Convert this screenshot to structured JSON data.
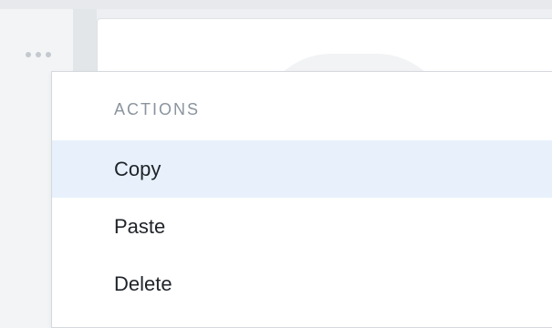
{
  "window": {
    "more_icon": "ellipsis-horizontal-icon"
  },
  "menu": {
    "heading": "ACTIONS",
    "items": [
      {
        "label": "Copy",
        "active": true
      },
      {
        "label": "Paste",
        "active": false
      },
      {
        "label": "Delete",
        "active": false
      }
    ],
    "highlight_color": "#e8f1fb",
    "heading_color": "#8a949e",
    "text_color": "#1f2329"
  }
}
